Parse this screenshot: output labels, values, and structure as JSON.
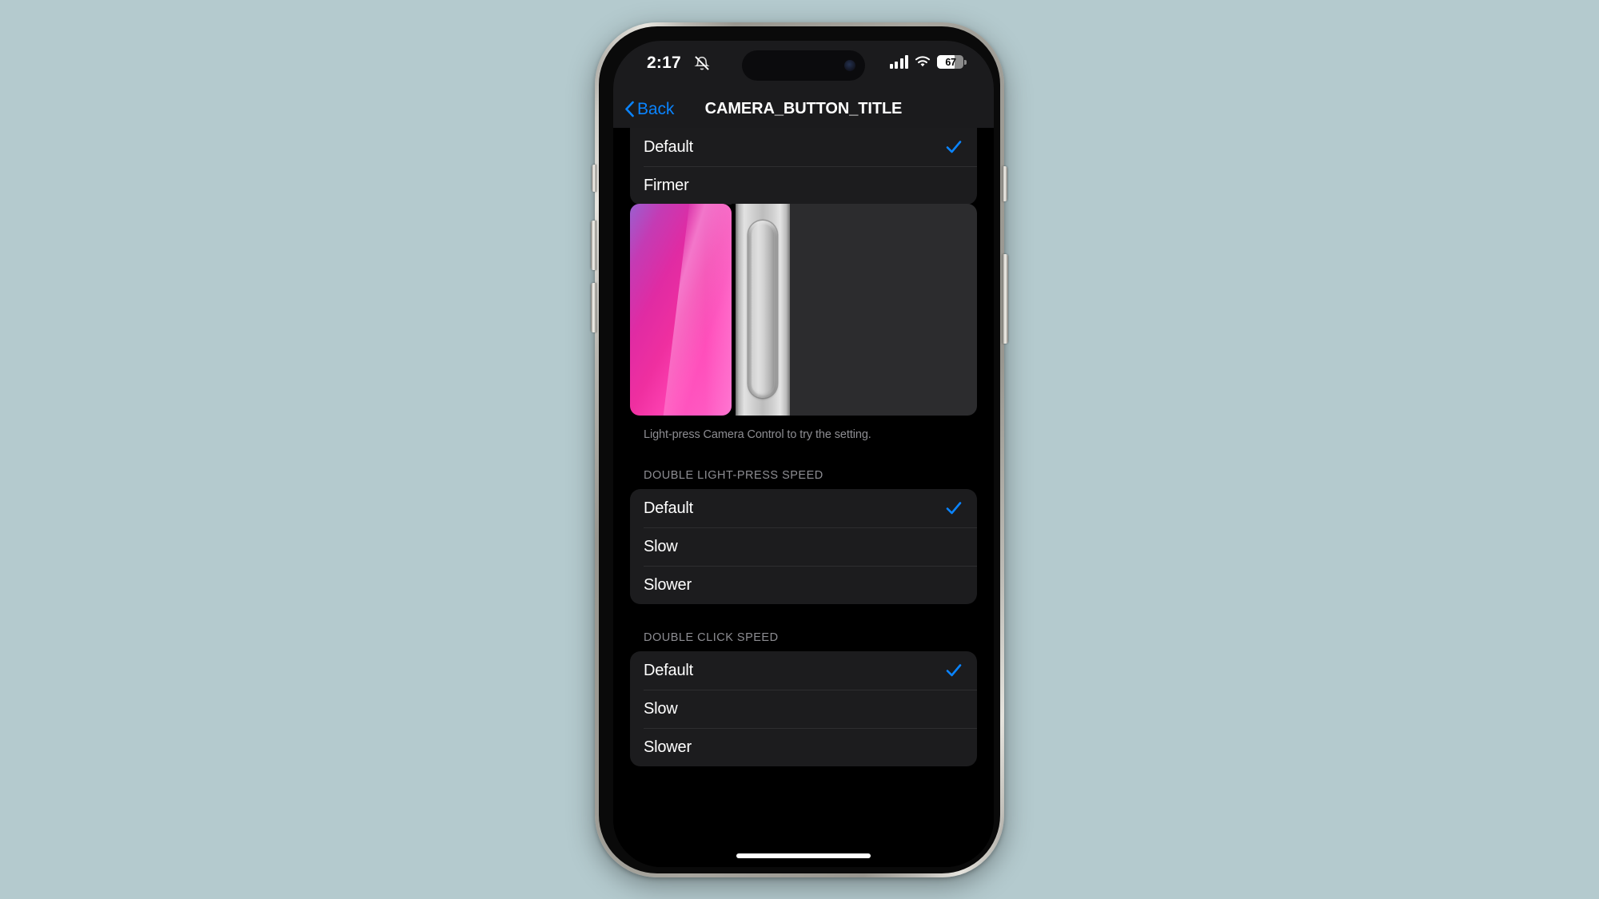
{
  "device": {
    "frame_color": "#a8a69f",
    "screen_background": "#000000",
    "page_background": "#b4cace"
  },
  "status_bar": {
    "time": "2:17",
    "mute_icon": "bell-slash-icon",
    "signal_icon": "cellular-signal-icon",
    "signal_bars": 4,
    "wifi_icon": "wifi-icon",
    "battery_percent": "67",
    "battery_level": 67
  },
  "nav_bar": {
    "back_icon": "chevron-left-icon",
    "back_label": "Back",
    "title": "CAMERA_BUTTON_TITLE",
    "accent_color": "#0a84ff"
  },
  "sections": [
    {
      "header": "",
      "clipped": true,
      "rows": [
        {
          "label": "Default",
          "checked": true
        },
        {
          "label": "Firmer",
          "checked": false
        }
      ]
    },
    {
      "header": "DOUBLE LIGHT-PRESS SPEED",
      "clipped": false,
      "rows": [
        {
          "label": "Default",
          "checked": true
        },
        {
          "label": "Slow",
          "checked": false
        },
        {
          "label": "Slower",
          "checked": false
        }
      ]
    },
    {
      "header": "DOUBLE CLICK SPEED",
      "clipped": false,
      "rows": [
        {
          "label": "Default",
          "checked": true
        },
        {
          "label": "Slow",
          "checked": false
        },
        {
          "label": "Slower",
          "checked": false
        }
      ]
    }
  ],
  "preview": {
    "name": "camera-control-preview",
    "caption": "Light-press Camera Control to try the setting.",
    "pink_panel_color": "#ef2fa0",
    "metal_color": "#d0d0d0",
    "dark_panel_color": "#2c2c2e"
  },
  "home_indicator": {
    "color": "#ffffff"
  }
}
